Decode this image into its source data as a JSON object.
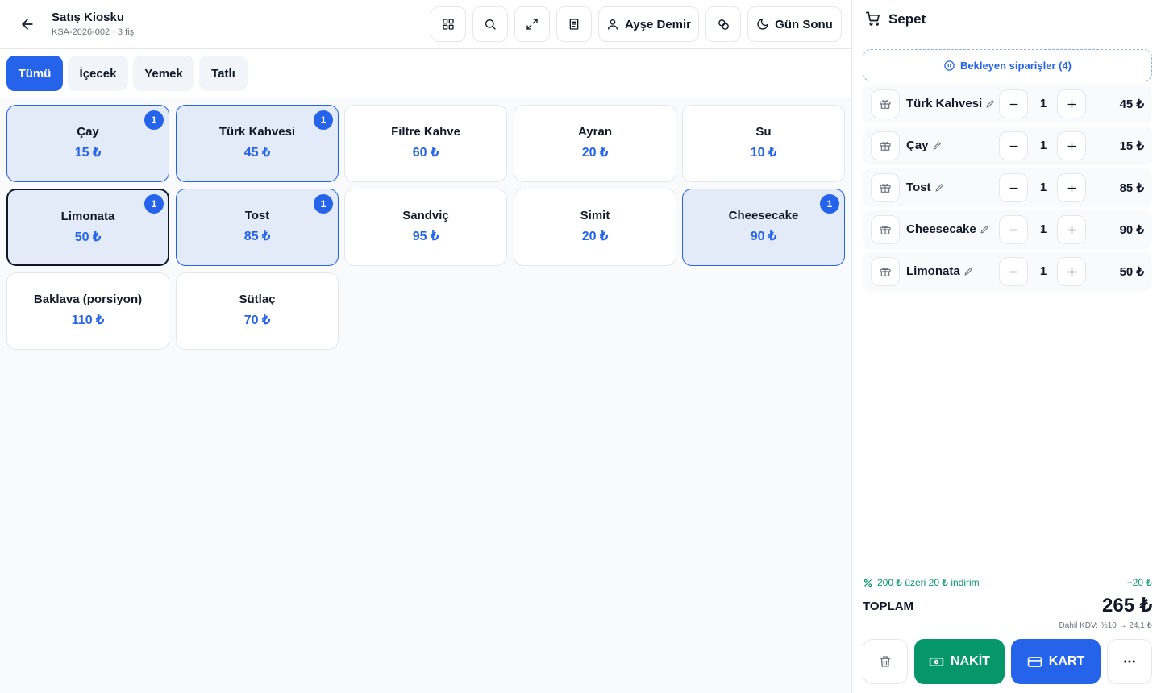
{
  "header": {
    "title": "Satış Kiosku",
    "subtitle": "KSA-2026-002 · 3 fiş",
    "user_label": "Ayşe Demir",
    "day_end_label": "Gün Sonu"
  },
  "tabs": [
    {
      "label": "Tümü",
      "active": true
    },
    {
      "label": "İçecek",
      "active": false
    },
    {
      "label": "Yemek",
      "active": false
    },
    {
      "label": "Tatlı",
      "active": false
    }
  ],
  "products": [
    {
      "name": "Çay",
      "price": "15 ₺",
      "count": "1",
      "selected": true
    },
    {
      "name": "Türk Kahvesi",
      "price": "45 ₺",
      "count": "1",
      "selected": true
    },
    {
      "name": "Filtre Kahve",
      "price": "60 ₺",
      "count": "",
      "selected": false
    },
    {
      "name": "Ayran",
      "price": "20 ₺",
      "count": "",
      "selected": false
    },
    {
      "name": "Su",
      "price": "10 ₺",
      "count": "",
      "selected": false
    },
    {
      "name": "Limonata",
      "price": "50 ₺",
      "count": "1",
      "selected": true,
      "focused": true
    },
    {
      "name": "Tost",
      "price": "85 ₺",
      "count": "1",
      "selected": true
    },
    {
      "name": "Sandviç",
      "price": "95 ₺",
      "count": "",
      "selected": false
    },
    {
      "name": "Simit",
      "price": "20 ₺",
      "count": "",
      "selected": false
    },
    {
      "name": "Cheesecake",
      "price": "90 ₺",
      "count": "1",
      "selected": true
    },
    {
      "name": "Baklava (porsiyon)",
      "price": "110 ₺",
      "count": "",
      "selected": false
    },
    {
      "name": "Sütlaç",
      "price": "70 ₺",
      "count": "",
      "selected": false
    }
  ],
  "cart": {
    "title": "Sepet",
    "pending_label": "Bekleyen siparişler (4)",
    "items": [
      {
        "name": "Türk Kahvesi",
        "qty": "1",
        "total": "45 ₺"
      },
      {
        "name": "Çay",
        "qty": "1",
        "total": "15 ₺"
      },
      {
        "name": "Tost",
        "qty": "1",
        "total": "85 ₺"
      },
      {
        "name": "Cheesecake",
        "qty": "1",
        "total": "90 ₺"
      },
      {
        "name": "Limonata",
        "qty": "1",
        "total": "50 ₺"
      }
    ],
    "promo_label": "200 ₺ üzeri 20 ₺ indirim",
    "promo_value": "−20 ₺",
    "total_label": "TOPLAM",
    "total_value": "265 ₺",
    "vat_label": "Dahil KDV: %10 → 24,1 ₺",
    "cash_label": "NAKİT",
    "card_label": "KART"
  },
  "colors": {
    "accent": "#2563eb",
    "success": "#059669",
    "selected_bg": "#e3eaf8"
  },
  "icons": [
    "arrow-left-icon",
    "grid-icon",
    "search-icon",
    "expand-icon",
    "receipt-icon",
    "user-icon",
    "link-icon",
    "moon-icon",
    "cart-icon",
    "pause-icon",
    "gift-icon",
    "pencil-icon",
    "minus-icon",
    "plus-icon",
    "percent-icon",
    "trash-icon",
    "banknote-icon",
    "credit-card-icon",
    "more-icon"
  ]
}
